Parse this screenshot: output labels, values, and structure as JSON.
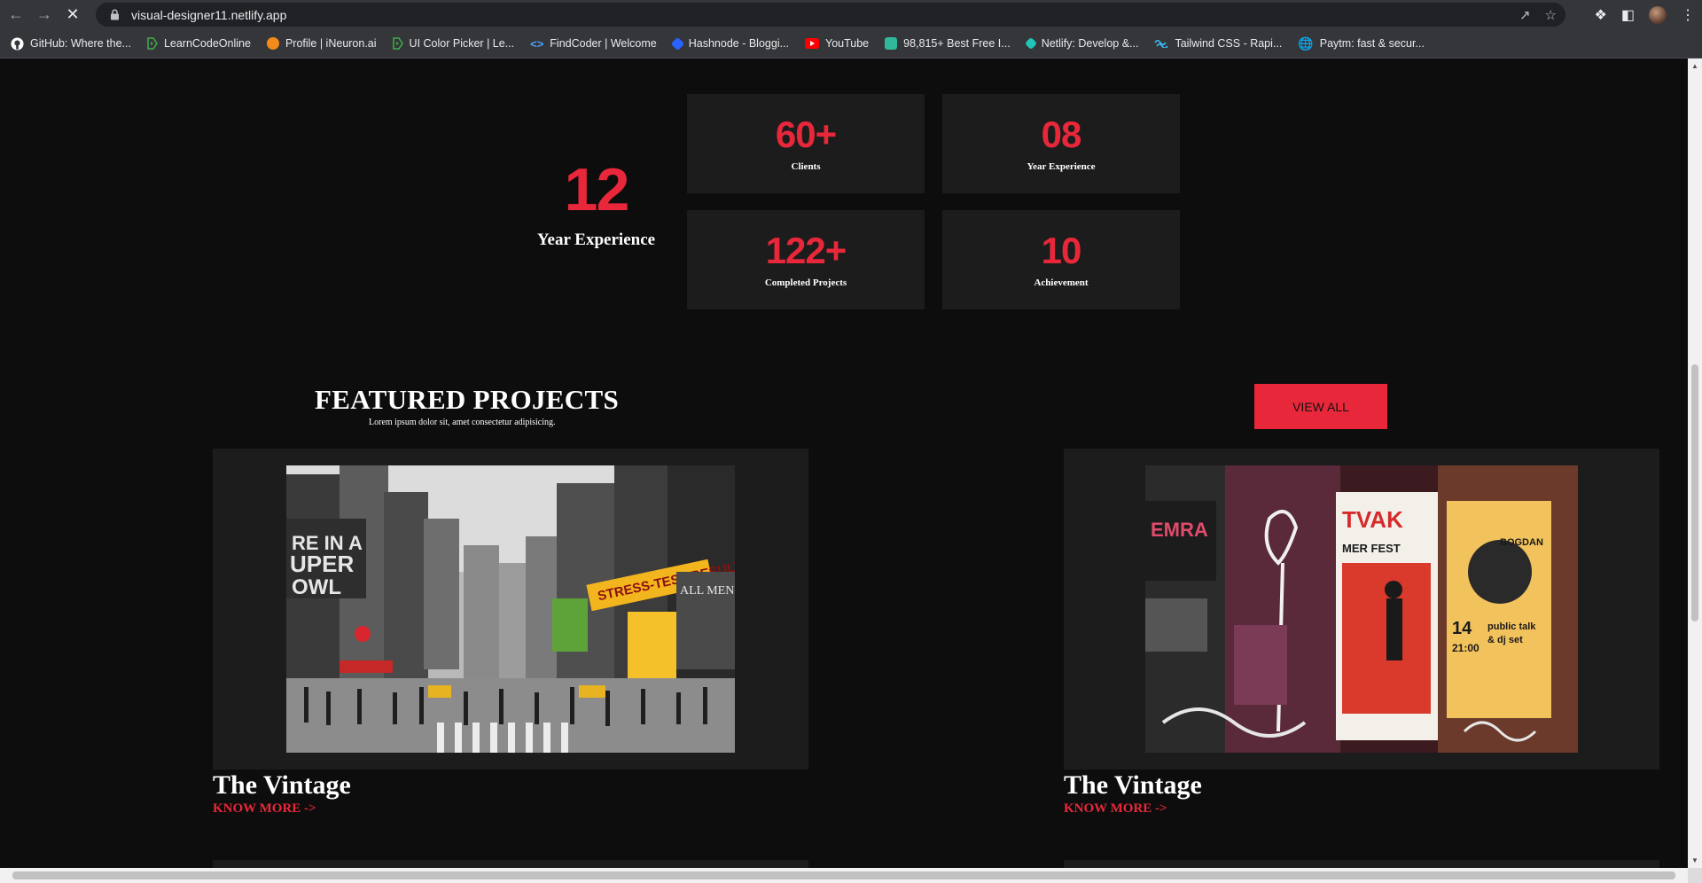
{
  "browser": {
    "url": "visual-designer11.netlify.app",
    "bookmarks": [
      {
        "label": "GitHub: Where the...",
        "color": "#ffffff"
      },
      {
        "label": "LearnCodeOnline",
        "color": "#3fae49"
      },
      {
        "label": "Profile | iNeuron.ai",
        "color": "#f28b1a"
      },
      {
        "label": "UI Color Picker | Le...",
        "color": "#3fae49"
      },
      {
        "label": "FindCoder | Welcome",
        "color": "#4da3ff"
      },
      {
        "label": "Hashnode - Bloggi...",
        "color": "#2962ff"
      },
      {
        "label": "YouTube",
        "color": "#ff0000"
      },
      {
        "label": "98,815+ Best Free I...",
        "color": "#2fb99a"
      },
      {
        "label": "Netlify: Develop &...",
        "color": "#20c6b7"
      },
      {
        "label": "Tailwind CSS - Rapi...",
        "color": "#38bdf8"
      },
      {
        "label": "Paytm: fast & secur...",
        "color": "#9aa0a6"
      }
    ]
  },
  "experience": {
    "big_number": "12",
    "big_label": "Year Experience",
    "stats": [
      {
        "value": "60+",
        "label": "Clients"
      },
      {
        "value": "08",
        "label": "Year Experience"
      },
      {
        "value": "122+",
        "label": "Completed Projects"
      },
      {
        "value": "10",
        "label": "Achievement"
      }
    ]
  },
  "featured": {
    "title": "FEATURED PROJECTS",
    "subtitle": "Lorem ipsum dolor sit, amet consectetur adipisicing.",
    "view_all": "VIEW ALL",
    "projects": [
      {
        "title": "The Vintage",
        "link": "KNOW MORE ->"
      },
      {
        "title": "The Vintage",
        "link": "KNOW MORE ->"
      }
    ]
  },
  "colors": {
    "accent": "#e8283a",
    "background": "#0e0d0d",
    "card": "#1d1c1c"
  }
}
